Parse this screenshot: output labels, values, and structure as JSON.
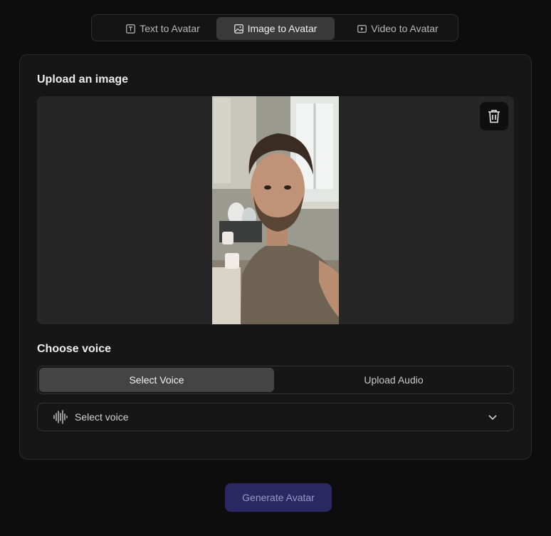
{
  "tabs": [
    {
      "label": "Text to Avatar",
      "icon": "text-box-icon",
      "active": false
    },
    {
      "label": "Image to Avatar",
      "icon": "image-icon",
      "active": true
    },
    {
      "label": "Video to Avatar",
      "icon": "video-icon",
      "active": false
    }
  ],
  "upload": {
    "title": "Upload an image",
    "delete_icon": "trash-icon"
  },
  "voice": {
    "title": "Choose voice",
    "options": [
      {
        "label": "Select Voice",
        "active": true
      },
      {
        "label": "Upload Audio",
        "active": false
      }
    ],
    "dropdown": {
      "placeholder": "Select voice",
      "icon": "audio-wave-icon",
      "chevron": "chevron-down-icon"
    }
  },
  "actions": {
    "generate_label": "Generate Avatar"
  },
  "colors": {
    "background": "#0d0d0d",
    "card": "#161616",
    "accent_button": "#2a2862",
    "active_tab": "#3a3a3a"
  }
}
